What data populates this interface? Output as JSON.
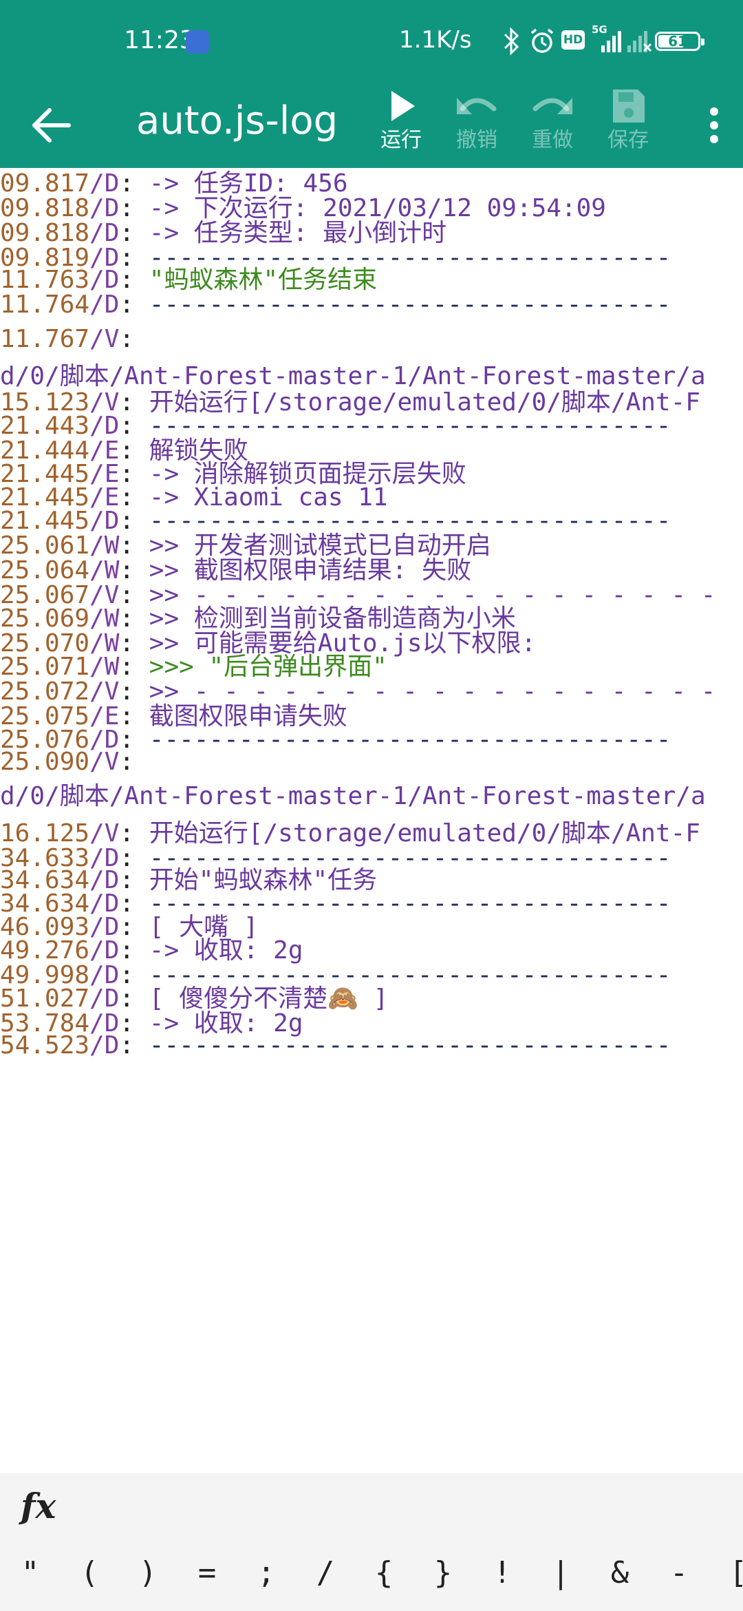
{
  "status_bar": {
    "time": "11:23",
    "net_speed": "1.1K/s",
    "battery": "61",
    "battery_level": 0.61,
    "hd_badge": "HD",
    "network": "5G"
  },
  "toolbar": {
    "title": "auto.js-log",
    "run_label": "运行",
    "undo_label": "撤销",
    "redo_label": "重做",
    "save_label": "保存"
  },
  "log": [
    {
      "ts": "09.817",
      "lv": "D",
      "msg": "-> 任务ID: 456"
    },
    {
      "ts": "09.818",
      "lv": "D",
      "msg": "-> 下次运行: 2021/03/12 09:54:09"
    },
    {
      "ts": "09.818",
      "lv": "D",
      "msg": "-> 任务类型: 最小倒计时"
    },
    {
      "ts": "09.819",
      "lv": "D",
      "msg": "-----------------------------------"
    },
    {
      "ts": "11.763",
      "lv": "D",
      "msg": "\"蚂蚁森林\"任务结束",
      "style": "green"
    },
    {
      "ts": "11.764",
      "lv": "D",
      "msg": "-----------------------------------"
    },
    {
      "ts": "11.767",
      "lv": "V",
      "msg": ""
    },
    {
      "raw": "d/0/脚本/Ant-Forest-master-1/Ant-Forest-master/a"
    },
    {
      "ts": "15.123",
      "lv": "V",
      "msg": "开始运行[/storage/emulated/0/脚本/Ant-F"
    },
    {
      "ts": "21.443",
      "lv": "D",
      "msg": "-----------------------------------"
    },
    {
      "ts": "21.444",
      "lv": "E",
      "msg": "解锁失败"
    },
    {
      "ts": "21.445",
      "lv": "E",
      "msg": "-> 消除解锁页面提示层失败"
    },
    {
      "ts": "21.445",
      "lv": "E",
      "msg": "-> Xiaomi cas 11"
    },
    {
      "ts": "21.445",
      "lv": "D",
      "msg": "-----------------------------------"
    },
    {
      "ts": "25.061",
      "lv": "W",
      "msg": ">> 开发者测试模式已自动开启"
    },
    {
      "ts": "25.064",
      "lv": "W",
      "msg": ">> 截图权限申请结果: 失败"
    },
    {
      "ts": "25.067",
      "lv": "V",
      "msg": ">> - - - - - - - - - - - - - - - - - -"
    },
    {
      "ts": "25.069",
      "lv": "W",
      "msg": ">> 检测到当前设备制造商为小米"
    },
    {
      "ts": "25.070",
      "lv": "W",
      "msg": ">> 可能需要给Auto.js以下权限:"
    },
    {
      "ts": "25.071",
      "lv": "W",
      "msg": ">>> \"后台弹出界面\"",
      "style": "green-partial"
    },
    {
      "ts": "25.072",
      "lv": "V",
      "msg": ">> - - - - - - - - - - - - - - - - - -"
    },
    {
      "ts": "25.075",
      "lv": "E",
      "msg": "截图权限申请失败"
    },
    {
      "ts": "25.076",
      "lv": "D",
      "msg": "-----------------------------------"
    },
    {
      "ts": "25.090",
      "lv": "V",
      "msg": ""
    },
    {
      "raw": "d/0/脚本/Ant-Forest-master-1/Ant-Forest-master/a"
    },
    {
      "ts": "16.125",
      "lv": "V",
      "msg": "开始运行[/storage/emulated/0/脚本/Ant-F"
    },
    {
      "ts": "34.633",
      "lv": "D",
      "msg": "-----------------------------------"
    },
    {
      "ts": "34.634",
      "lv": "D",
      "msg": "开始\"蚂蚁森林\"任务"
    },
    {
      "ts": "34.634",
      "lv": "D",
      "msg": "-----------------------------------"
    },
    {
      "ts": "46.093",
      "lv": "D",
      "msg": "[ 大嘴 ]"
    },
    {
      "ts": "49.276",
      "lv": "D",
      "msg": "-> 收取: 2g"
    },
    {
      "ts": "49.998",
      "lv": "D",
      "msg": "-----------------------------------"
    },
    {
      "ts": "51.027",
      "lv": "D",
      "msg": "[ 傻傻分不清楚🙈 ]"
    },
    {
      "ts": "53.784",
      "lv": "D",
      "msg": "-> 收取: 2g"
    },
    {
      "ts": "54.523",
      "lv": "D",
      "msg": "-----------------------------------"
    }
  ],
  "bottom_bar": {
    "fx_label": "fx",
    "symbols": [
      "\"",
      "(",
      ")",
      "=",
      ";",
      "/",
      "{",
      "}",
      "!",
      "|",
      "&",
      "-",
      "["
    ]
  }
}
